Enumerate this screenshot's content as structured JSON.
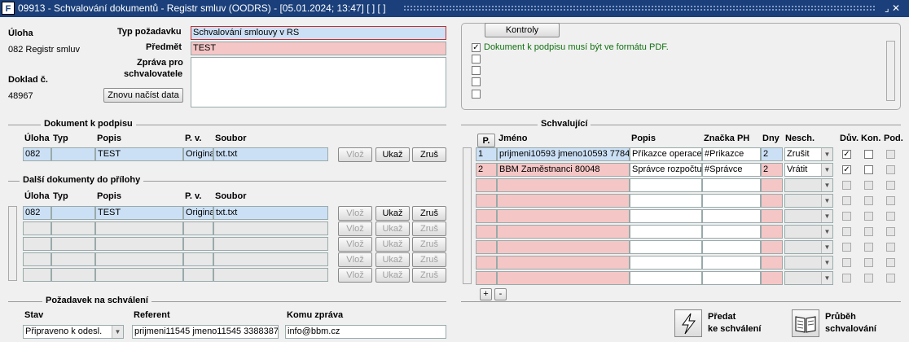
{
  "window": {
    "title": "09913 - Schvalování dokumentů - Registr smluv (OODRS) - [05.01.2024; 13:47]  [ ]  [ ]",
    "logo": "F",
    "controls": "⌟ ✕"
  },
  "left": {
    "uloha_label": "Úloha",
    "uloha_value": "082 Registr smluv",
    "doklad_label": "Doklad č.",
    "doklad_value": "48967",
    "typ_label": "Typ požadavku",
    "typ_value": "Schvalování smlouvy v RS",
    "predmet_label": "Předmět",
    "predmet_value": "TEST",
    "zprava_label1": "Zpráva pro",
    "zprava_label2": "schvalovatele",
    "reload_button": "Znovu načíst data"
  },
  "kontroly": {
    "tab": "Kontroly",
    "items": [
      "Dokument k podpisu musí být ve formátu PDF.",
      "",
      "",
      "",
      ""
    ]
  },
  "doc": {
    "section": "Dokument k podpisu",
    "headers": [
      "Úloha",
      "Typ",
      "Popis",
      "P. v.",
      "Soubor"
    ],
    "row": {
      "uloha": "082",
      "typ": "",
      "popis": "TEST",
      "pv": "Origina",
      "soubor": "txt.txt"
    },
    "buttons": [
      "Vlož",
      "Ukaž",
      "Zruš"
    ]
  },
  "attach": {
    "section": "Další dokumenty do přílohy",
    "headers": [
      "Úloha",
      "Typ",
      "Popis",
      "P. v.",
      "Soubor"
    ],
    "row": {
      "uloha": "082",
      "typ": "",
      "popis": "TEST",
      "pv": "Origina",
      "soubor": "txt.txt"
    },
    "buttons": [
      "Vlož",
      "Ukaž",
      "Zruš"
    ]
  },
  "approvers": {
    "section": "Schvalující",
    "headers": [
      "P.",
      "Jméno",
      "Popis",
      "Značka PH",
      "Dny",
      "Nesch.",
      "Dův.",
      "Kon.",
      "Pod."
    ],
    "rows": [
      {
        "p": "1",
        "jmeno": "prijmeni10593 jmeno10593 77848",
        "popis": "Příkazce operace",
        "znacka": "#Prikazce",
        "dny": "2",
        "nesch": "Zrušit"
      },
      {
        "p": "2",
        "jmeno": "BBM Zaměstnanci 80048",
        "popis": "Správce rozpočtu",
        "znacka": "#Správce",
        "dny": "2",
        "nesch": "Vrátit"
      }
    ],
    "plus": "+",
    "minus": "-"
  },
  "pozadavek": {
    "section": "Požadavek na schválení",
    "stav_label": "Stav",
    "stav_value": "Připraveno k odesl.",
    "referent_label": "Referent",
    "referent_value": "prijmeni11545 jmeno11545 33883878",
    "komu_label": "Komu zpráva",
    "komu_value": "info@bbm.cz"
  },
  "actions": {
    "predat1": "Předat",
    "predat2": "ke schválení",
    "prubeh1": "Průběh",
    "prubeh2": "schvalování"
  }
}
